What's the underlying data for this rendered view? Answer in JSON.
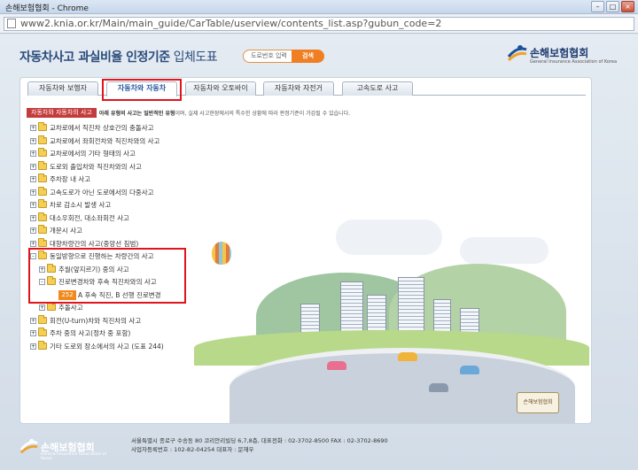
{
  "window": {
    "title": "손해보험협회 - Chrome",
    "url": "www2.knia.or.kr/Main/main_guide/CarTable/userview/contents_list.asp?gubun_code=2"
  },
  "header": {
    "title_bold": "자동차사고 과실비율 인정기준",
    "title_normal": " 입체도표",
    "search_placeholder": "도로번호 입력",
    "search_button": "검색",
    "logo_name": "손해보험협회",
    "logo_sub": "General Insurance Association of Korea"
  },
  "tabs": [
    {
      "label": "자동차와 보행자",
      "active": false
    },
    {
      "label": "자동차와 자동차",
      "active": true
    },
    {
      "label": "자동차와 오토바이",
      "active": false
    },
    {
      "label": "자동차와 자전거",
      "active": false
    },
    {
      "label": "고속도로 사고",
      "active": false
    }
  ],
  "description": {
    "badge": "자동차와 자동차의 사고",
    "text_bold": "아래 유형의 사고는 일반적인 유형",
    "text_rest": "이며, 실제 사고현장에서의 특수한 상황에 따라 판정기준이 가감될 수 있습니다."
  },
  "tree": [
    {
      "label": "교차로에서 직진차 상호간의 충돌사고"
    },
    {
      "label": "교차로에서 좌회전차와 직진차와의 사고"
    },
    {
      "label": "교차로에서의 기타 형태의 사고"
    },
    {
      "label": "도로외 출입차와 직진차와의 사고"
    },
    {
      "label": "주차장 내 사고"
    },
    {
      "label": "고속도로가 아닌 도로에서의 다중사고"
    },
    {
      "label": "차로 감소시 발생 사고"
    },
    {
      "label": "대소우회전, 대소좌회전 사고"
    },
    {
      "label": "개문시 사고"
    },
    {
      "label": "대향차량간의 사고(중앙선 침범)"
    },
    {
      "label": "동일방향으로 진행하는 차량간의 사고"
    },
    {
      "label": "추월(앞지르기) 중의 사고"
    },
    {
      "label": "진로변경차와 후속 직진차와의 사고"
    },
    {
      "num": "252",
      "label": "A 후속 직진, B 선행 진로변경"
    },
    {
      "label": "추돌사고"
    },
    {
      "label": "회전(U-turn)차와 직진차의 사고"
    },
    {
      "label": "주차 중의 사고(정차 중 포함)"
    },
    {
      "label": "기타 도로외 장소에서의 사고 (도표 244)"
    }
  ],
  "illustration": {
    "sign_text": "손해보험협회"
  },
  "footer": {
    "logo_name": "손해보험협회",
    "logo_sub": "General Insurance Association of Korea",
    "line1": "서울특별시 종로구 수송동 80 코리안리빌딩 6,7,8층, 대표전화 : 02-3702-8500    FAX : 02-3702-8690",
    "line2": "사업자등록번호 : 102-82-04254  대표자 : 문재우"
  }
}
